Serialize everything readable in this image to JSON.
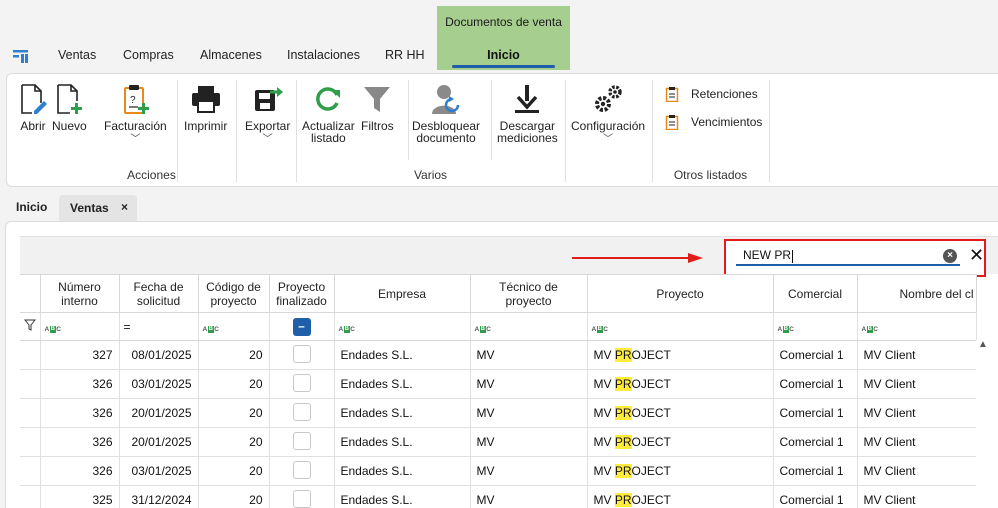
{
  "menubar": {
    "items": [
      "Ventas",
      "Compras",
      "Almacenes",
      "Instalaciones",
      "RR HH"
    ],
    "context_group_title": "Documentos de venta",
    "context_tab": "Inicio"
  },
  "ribbon": {
    "acciones": {
      "abrir": "Abrir",
      "nuevo": "Nuevo",
      "facturacion": "Facturación",
      "imprimir": "Imprimir",
      "exportar": "Exportar",
      "group_label": "Acciones"
    },
    "varios": {
      "actualizar_l1": "Actualizar",
      "actualizar_l2": "listado",
      "filtros": "Filtros",
      "desbloquear_l1": "Desbloquear",
      "desbloquear_l2": "documento",
      "descargar_l1": "Descargar",
      "descargar_l2": "mediciones",
      "group_label": "Varios"
    },
    "configuracion": "Configuración",
    "otros": {
      "retenciones": "Retenciones",
      "vencimientos": "Vencimientos",
      "group_label": "Otros listados"
    }
  },
  "doc_tabs": {
    "home": "Inicio",
    "active": "Ventas",
    "close": "×"
  },
  "search": {
    "value": "NEW PR",
    "clear": "×",
    "close": "✕"
  },
  "grid": {
    "headers": {
      "numero_l1": "Número",
      "numero_l2": "interno",
      "fecha_l1": "Fecha de",
      "fecha_l2": "solicitud",
      "codigo_l1": "Código de",
      "codigo_l2": "proyecto",
      "finalizado_l1": "Proyecto",
      "finalizado_l2": "finalizado",
      "empresa": "Empresa",
      "tecnico_l1": "Técnico de",
      "tecnico_l2": "proyecto",
      "proyecto": "Proyecto",
      "comercial": "Comercial",
      "cliente": "Nombre del cl"
    },
    "filter": {
      "equals": "=",
      "dash": "–"
    },
    "rows": [
      {
        "numero": "327",
        "fecha": "08/01/2025",
        "codigo": "20",
        "empresa": "Endades S.L.",
        "tecnico": "MV",
        "proyecto_pre": "MV ",
        "proyecto_hl": "PR",
        "proyecto_post": "OJECT",
        "comercial": "Comercial 1",
        "cliente": "MV Client"
      },
      {
        "numero": "326",
        "fecha": "03/01/2025",
        "codigo": "20",
        "empresa": "Endades S.L.",
        "tecnico": "MV",
        "proyecto_pre": "MV ",
        "proyecto_hl": "PR",
        "proyecto_post": "OJECT",
        "comercial": "Comercial 1",
        "cliente": "MV Client"
      },
      {
        "numero": "326",
        "fecha": "20/01/2025",
        "codigo": "20",
        "empresa": "Endades S.L.",
        "tecnico": "MV",
        "proyecto_pre": "MV ",
        "proyecto_hl": "PR",
        "proyecto_post": "OJECT",
        "comercial": "Comercial 1",
        "cliente": "MV Client"
      },
      {
        "numero": "326",
        "fecha": "20/01/2025",
        "codigo": "20",
        "empresa": "Endades S.L.",
        "tecnico": "MV",
        "proyecto_pre": "MV ",
        "proyecto_hl": "PR",
        "proyecto_post": "OJECT",
        "comercial": "Comercial 1",
        "cliente": "MV Client"
      },
      {
        "numero": "326",
        "fecha": "03/01/2025",
        "codigo": "20",
        "empresa": "Endades S.L.",
        "tecnico": "MV",
        "proyecto_pre": "MV ",
        "proyecto_hl": "PR",
        "proyecto_post": "OJECT",
        "comercial": "Comercial 1",
        "cliente": "MV Client"
      },
      {
        "numero": "325",
        "fecha": "31/12/2024",
        "codigo": "20",
        "empresa": "Endades S.L.",
        "tecnico": "MV",
        "proyecto_pre": "MV ",
        "proyecto_hl": "PR",
        "proyecto_post": "OJECT",
        "comercial": "Comercial 1",
        "cliente": "MV Client"
      }
    ]
  },
  "colors": {
    "accent": "#1f5ea8",
    "context_group": "#a6cf8f",
    "highlight": "#ffeb3b",
    "annotation_red": "#e21b1b",
    "icon_green": "#2e9e4a",
    "icon_orange": "#e8891c"
  }
}
